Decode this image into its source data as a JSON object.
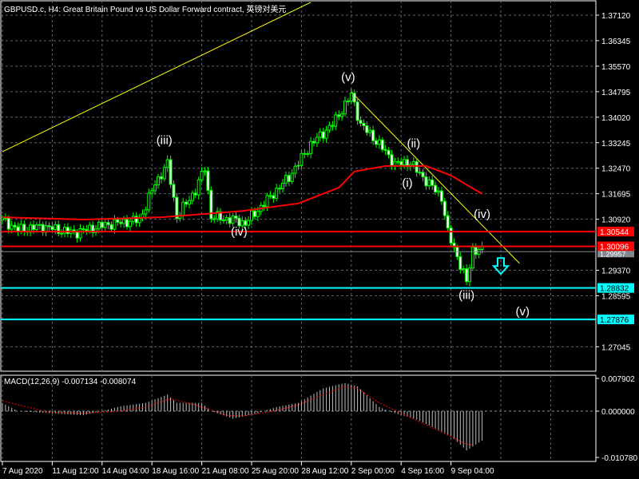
{
  "header": {
    "title": "GBPUSD.c, H4:  Great Britain Pound vs US Dollar Forward contract, 英镑对美元"
  },
  "chart_data": {
    "type": "candlestick",
    "symbol": "GBPUSD.c",
    "timeframe": "H4",
    "price_ticks": [
      "1.37120",
      "1.36345",
      "1.35570",
      "1.34795",
      "1.34020",
      "1.33245",
      "1.32470",
      "1.31695",
      "1.30920",
      "1.29370",
      "1.28595",
      "1.27045"
    ],
    "ylim": [
      1.264,
      1.3762
    ],
    "time_labels": [
      "7 Aug 2020",
      "11 Aug 12:00",
      "14 Aug 04:00",
      "18 Aug 16:00",
      "21 Aug 08:00",
      "25 Aug 20:00",
      "28 Aug 12:00",
      "2 Sep 00:00",
      "4 Sep 16:00",
      "9 Sep 04:00"
    ],
    "bars_per_time_label": 16,
    "close_waypoints": [
      [
        0,
        1.309
      ],
      [
        5,
        1.306
      ],
      [
        13,
        1.307
      ],
      [
        23,
        1.305
      ],
      [
        33,
        1.3075
      ],
      [
        44,
        1.309
      ],
      [
        49,
        1.32
      ],
      [
        53,
        1.326
      ],
      [
        56,
        1.31
      ],
      [
        62,
        1.318
      ],
      [
        65,
        1.325
      ],
      [
        67,
        1.31
      ],
      [
        74,
        1.309
      ],
      [
        78,
        1.308
      ],
      [
        85,
        1.315
      ],
      [
        92,
        1.322
      ],
      [
        99,
        1.332
      ],
      [
        106,
        1.338
      ],
      [
        112,
        1.347
      ],
      [
        115,
        1.338
      ],
      [
        121,
        1.332
      ],
      [
        126,
        1.326
      ],
      [
        131,
        1.3265
      ],
      [
        133,
        1.324
      ],
      [
        137,
        1.32
      ],
      [
        141,
        1.316
      ],
      [
        143,
        1.305
      ],
      [
        146,
        1.298
      ],
      [
        149,
        1.29
      ],
      [
        151,
        1.3
      ],
      [
        154,
        1.2996
      ]
    ],
    "moving_average": [
      [
        0,
        1.3098
      ],
      [
        26,
        1.3091
      ],
      [
        51,
        1.3098
      ],
      [
        77,
        1.3117
      ],
      [
        95,
        1.314
      ],
      [
        108,
        1.3188
      ],
      [
        113,
        1.3237
      ],
      [
        123,
        1.3254
      ],
      [
        136,
        1.3254
      ],
      [
        144,
        1.3225
      ],
      [
        154,
        1.3169
      ]
    ],
    "trendlines": [
      {
        "from": [
          0,
          1.3297
        ],
        "to": [
          99,
          1.3751
        ],
        "color": "#ffff00"
      },
      {
        "from": [
          112,
          1.3479
        ],
        "to": [
          166,
          1.2958
        ],
        "color": "#ffff00"
      }
    ],
    "horizontal_levels": [
      {
        "price": "1.30544",
        "color": "#ff0000"
      },
      {
        "price": "1.30096",
        "color": "#ff0000"
      },
      {
        "price": "1.28832",
        "color": "#00ffff"
      },
      {
        "price": "1.27876",
        "color": "#00ffff"
      }
    ],
    "bid": {
      "price": "1.29957",
      "color": "#808890"
    },
    "wave_labels": [
      {
        "text": "(iii)",
        "bar": 52,
        "price": 1.332
      },
      {
        "text": "(iv)",
        "bar": 76,
        "price": 1.3043
      },
      {
        "text": "(v)",
        "bar": 111,
        "price": 1.3512
      },
      {
        "text": "(i)",
        "bar": 130,
        "price": 1.319
      },
      {
        "text": "(ii)",
        "bar": 132,
        "price": 1.331
      },
      {
        "text": "(iv)",
        "bar": 154,
        "price": 1.3096
      },
      {
        "text": "(iii)",
        "bar": 149,
        "price": 1.285
      },
      {
        "text": "(v)",
        "bar": 167,
        "price": 1.28
      }
    ],
    "arrow": {
      "bar": 160,
      "price": 1.2945,
      "direction": "down",
      "color": "#00ffff"
    },
    "macd": {
      "label": "MACD(12,26,9) -0.007134 -0.008074",
      "ticks": [
        "0.007902",
        "0.000000",
        "-0.010780"
      ],
      "ylim": [
        -0.01078,
        0.007902
      ],
      "main_waypoints": [
        [
          0,
          0.002
        ],
        [
          5,
          0.0
        ],
        [
          15,
          -0.0005
        ],
        [
          26,
          -0.001
        ],
        [
          33,
          0.0002
        ],
        [
          38,
          0.0012
        ],
        [
          46,
          0.002
        ],
        [
          53,
          0.004
        ],
        [
          56,
          0.002
        ],
        [
          64,
          0.002
        ],
        [
          67,
          0.0
        ],
        [
          74,
          -0.0018
        ],
        [
          82,
          -0.0005
        ],
        [
          88,
          0.001
        ],
        [
          95,
          0.002
        ],
        [
          103,
          0.0055
        ],
        [
          110,
          0.0068
        ],
        [
          114,
          0.006
        ],
        [
          121,
          0.001
        ],
        [
          126,
          -0.0005
        ],
        [
          133,
          -0.002
        ],
        [
          144,
          -0.006
        ],
        [
          149,
          -0.0095
        ],
        [
          154,
          -0.0071
        ]
      ],
      "signal_waypoints": [
        [
          0,
          0.0025
        ],
        [
          8,
          0.001
        ],
        [
          15,
          -0.0003
        ],
        [
          26,
          -0.0005
        ],
        [
          33,
          -0.0002
        ],
        [
          38,
          0.0
        ],
        [
          46,
          0.001
        ],
        [
          54,
          0.003
        ],
        [
          62,
          0.0015
        ],
        [
          72,
          -0.001
        ],
        [
          77,
          -0.0012
        ],
        [
          87,
          0.0
        ],
        [
          95,
          0.0015
        ],
        [
          103,
          0.004
        ],
        [
          110,
          0.006
        ],
        [
          114,
          0.0055
        ],
        [
          121,
          0.002
        ],
        [
          128,
          -0.0005
        ],
        [
          138,
          -0.004
        ],
        [
          149,
          -0.008
        ],
        [
          151,
          -0.0081
        ]
      ]
    }
  }
}
